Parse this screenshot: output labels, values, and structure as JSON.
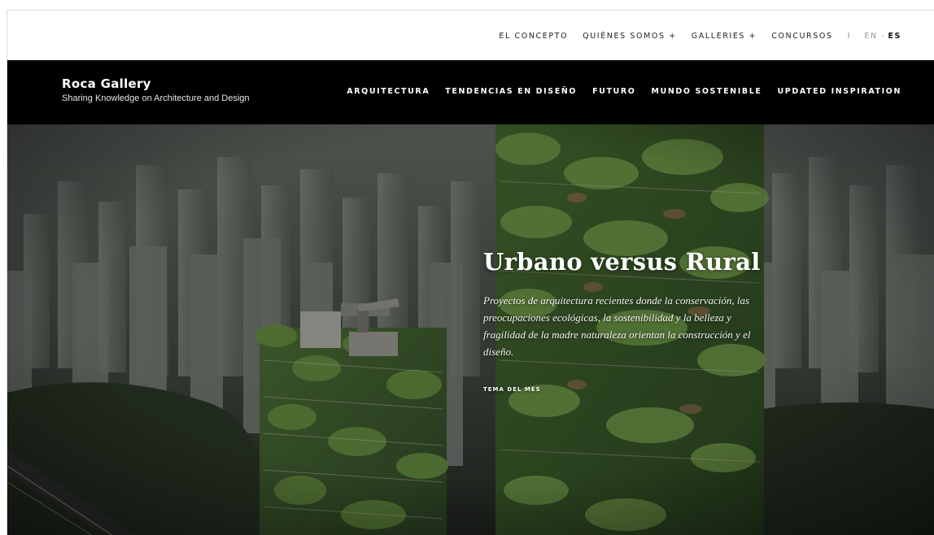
{
  "topbar": {
    "items": [
      "EL CONCEPTO",
      "QUIÉNES SOMOS +",
      "GALLERIES +",
      "CONCURSOS"
    ],
    "separator": "I",
    "lang": {
      "en": "EN",
      "dash": "–",
      "es": "ES"
    }
  },
  "header": {
    "brand_title": "Roca Gallery",
    "brand_tagline": "Sharing Knowledge on Architecture and Design",
    "nav": [
      "ARQUITECTURA",
      "TENDENCIAS EN DISEÑO",
      "FUTURO",
      "MUNDO SOSTENIBLE",
      "UPDATED INSPIRATION"
    ]
  },
  "hero": {
    "title": "Urbano versus Rural",
    "description": "Proyectos de arquitectura recientes donde la conservación, las preocupaciones ecológicas, la sostenibilidad y la belleza y fragilidad de la madre naturaleza orientan la construcción y el diseño.",
    "link_label": "TEMA DEL MES"
  },
  "colors": {
    "header_bg": "#000000",
    "topbar_bg": "#ffffff",
    "text_light": "#ffffff"
  }
}
